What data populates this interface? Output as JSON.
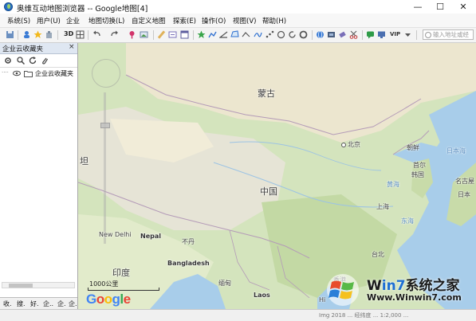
{
  "window": {
    "title": "奥维互动地图浏览器 -- Google地图[4]",
    "minimize_glyph": "—",
    "maximize_glyph": "☐",
    "close_glyph": "✕"
  },
  "menu": [
    "系统(S)",
    "用户(U)",
    "企业",
    "地图切换(L)",
    "自定义地图",
    "探索(E)",
    "操作(O)",
    "视图(V)",
    "帮助(H)"
  ],
  "toolbar": {
    "label_3d": "3D",
    "label_vip": "VIP",
    "address_placeholder": "输入地址或经"
  },
  "panel": {
    "title": "企业云收藏夹",
    "close": "×",
    "tree_root": "企业云收藏夹",
    "bottom_tabs": [
      "收.",
      "搜.",
      "好.",
      "企..",
      "企.",
      "企."
    ]
  },
  "map": {
    "labels": {
      "mongolia": "蒙古",
      "china": "中国",
      "india": "印度",
      "beijing": "北京",
      "north_korea": "朝鲜",
      "south_korea": "韩国",
      "japan_sea": "日本海",
      "new_delhi": "New Delhi",
      "nepal": "Nepal",
      "bhutan": "不丹",
      "bangladesh": "Bangladesh",
      "myanmar": "缅甸",
      "laos": "Laos",
      "taiwan": "台北",
      "huanghai": "黄海",
      "donghai": "东海",
      "hongkong": "香港",
      "hi": "Hi",
      "xinjiang_left": "坦",
      "shanghai": "上海",
      "seoul": "首尔",
      "nagoya": "名古屋",
      "japan": "日本"
    },
    "scale_label": "1000公里",
    "google_logo": [
      "G",
      "o",
      "o",
      "g",
      "l",
      "e"
    ],
    "google_colors": [
      "#4285f4",
      "#ea4335",
      "#fbbc05",
      "#4285f4",
      "#34a853",
      "#ea4335"
    ]
  },
  "watermark": {
    "brand_prefix": "W",
    "brand_mid": "in7",
    "brand_suffix": "系统之家",
    "url": "Www.Winwin7.com"
  },
  "status": {
    "text": "Img 2018 ... 经纬度 ... 1:2,000 ..."
  }
}
